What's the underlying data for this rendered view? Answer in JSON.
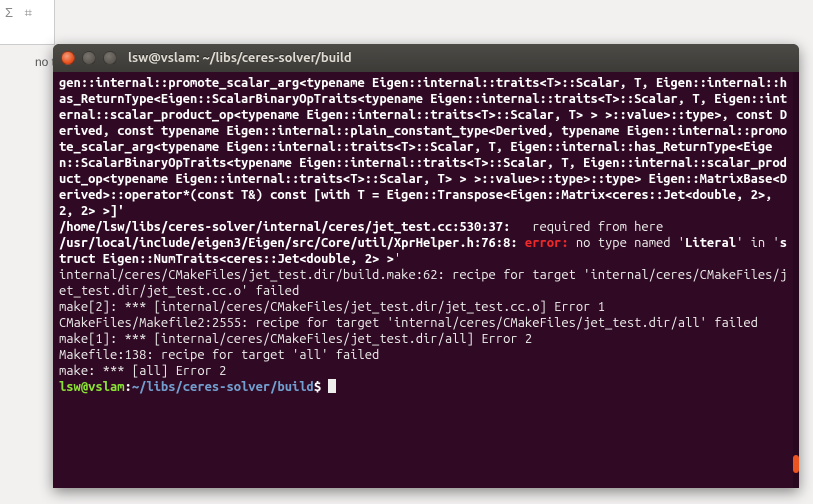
{
  "background": {
    "clipped_text": "no ty",
    "toolbar_symbols": "Σ ⌗"
  },
  "window": {
    "title": "lsw@vslam: ~/libs/ceres-solver/build"
  },
  "terminal": {
    "seg1": "gen::internal::promote_scalar_arg<typename Eigen::internal::traits<T>::Scalar, T, Eigen::internal::has_ReturnType<Eigen::ScalarBinaryOpTraits<typename Eigen::internal::traits<T>::Scalar, T, Eigen::internal::scalar_product_op<typename Eigen::internal::traits<T>::Scalar, T> > >::value>::type>, const Derived, const typename Eigen::internal::plain_constant_type<Derived, typename Eigen::internal::promote_scalar_arg<typename Eigen::internal::traits<T>::Scalar, T, Eigen::internal::has_ReturnType<Eigen::ScalarBinaryOpTraits<typename Eigen::internal::traits<T>::Scalar, T, Eigen::internal::scalar_product_op<typename Eigen::internal::traits<T>::Scalar, T> > >::value>::type>::type> Eigen::MatrixBase<Derived>::operator*(const T&) const [with T = Eigen::Transpose<Eigen::Matrix<ceres::Jet<double, 2>, 2, 2> >]'",
    "seg2": "/home/lsw/libs/ceres-solver/internal/ceres/jet_test.cc:530:37:",
    "seg2_tail": "   required from here",
    "seg3": "/usr/local/include/eigen3/Eigen/src/Core/util/XprHelper.h:76:8: ",
    "seg3_err": "error: ",
    "seg3_tail1": "no type named '",
    "seg3_literal": "Literal",
    "seg3_tail2": "' in '",
    "seg3_struct": "struct Eigen::NumTraits<ceres::Jet<double, 2> >",
    "seg3_tail3": "'",
    "seg4": "internal/ceres/CMakeFiles/jet_test.dir/build.make:62: recipe for target 'internal/ceres/CMakeFiles/jet_test.dir/jet_test.cc.o' failed",
    "seg5": "make[2]: *** [internal/ceres/CMakeFiles/jet_test.dir/jet_test.cc.o] Error 1",
    "seg6": "CMakeFiles/Makefile2:2555: recipe for target 'internal/ceres/CMakeFiles/jet_test.dir/all' failed",
    "seg7": "make[1]: *** [internal/ceres/CMakeFiles/jet_test.dir/all] Error 2",
    "seg8": "Makefile:138: recipe for target 'all' failed",
    "seg9": "make: *** [all] Error 2",
    "prompt_user": "lsw@vslam",
    "prompt_colon": ":",
    "prompt_path": "~/libs/ceres-solver/build",
    "prompt_dollar": "$ "
  }
}
